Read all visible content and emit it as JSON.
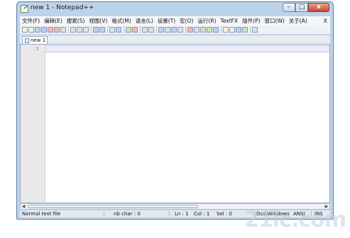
{
  "window": {
    "title": "new 1 - Notepad++"
  },
  "window_buttons": {
    "minimize": "–",
    "maximize": "□",
    "close": "x"
  },
  "menu": {
    "items": [
      "文件(F)",
      "编辑(E)",
      "搜索(S)",
      "视图(V)",
      "格式(M)",
      "语言(L)",
      "设置(T)",
      "宏(O)",
      "运行(R)",
      "TextFX",
      "插件(P)",
      "窗口(W)",
      "关于(A)"
    ],
    "close": "X"
  },
  "tab": {
    "label": "new 1"
  },
  "editor": {
    "line_number": "1"
  },
  "scrollbar": {
    "left_arrow": "◀",
    "right_arrow": "▶"
  },
  "status": {
    "file_type": "Normal text file",
    "char_count": "nb char : 0",
    "ln": "Ln : 1",
    "col": "Col : 1",
    "sel": "Sel : 0",
    "eol": "Dos\\Windows",
    "encoding": "ANSI",
    "mode": "INS"
  },
  "watermark": {
    "text": "21ic.com"
  }
}
